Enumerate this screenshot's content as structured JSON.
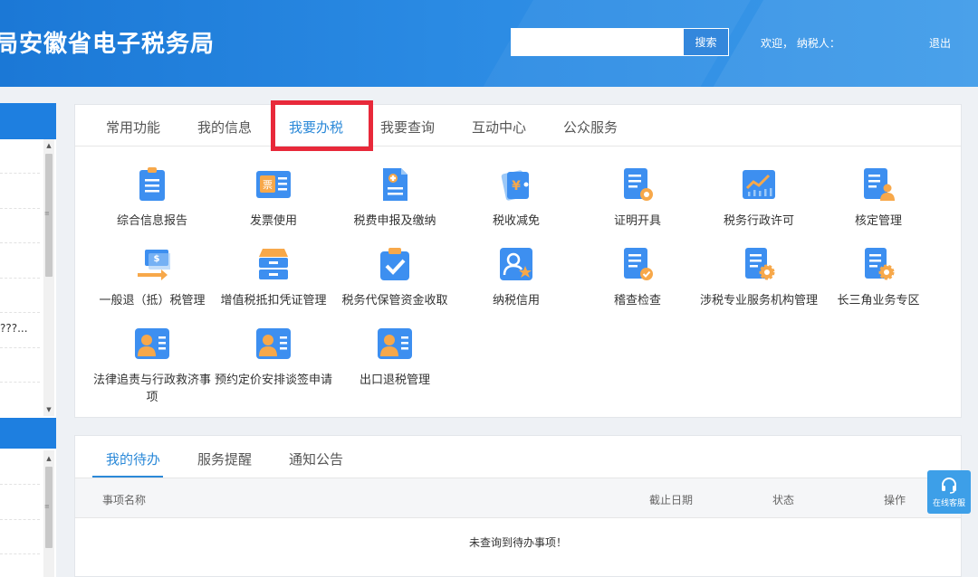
{
  "header": {
    "title": "局安徽省电子税务局",
    "search_placeholder": "",
    "search_button": "搜索",
    "welcome": "欢迎， 纳税人：",
    "logout": "退出"
  },
  "sidebar": {
    "truncated_item": "???..."
  },
  "tabs": [
    {
      "label": "常用功能"
    },
    {
      "label": "我的信息"
    },
    {
      "label": "我要办税",
      "active": true
    },
    {
      "label": "我要查询"
    },
    {
      "label": "互动中心"
    },
    {
      "label": "公众服务"
    }
  ],
  "tiles": [
    {
      "label": "综合信息报告",
      "icon": "report-doc-icon"
    },
    {
      "label": "发票使用",
      "icon": "invoice-icon"
    },
    {
      "label": "税费申报及缴纳",
      "icon": "declaration-icon"
    },
    {
      "label": "税收减免",
      "icon": "tax-reduction-icon"
    },
    {
      "label": "证明开具",
      "icon": "certificate-icon"
    },
    {
      "label": "税务行政许可",
      "icon": "admin-permit-chart-icon"
    },
    {
      "label": "核定管理",
      "icon": "verification-mgmt-icon"
    },
    {
      "label": "一般退（抵）税管理",
      "icon": "refund-money-icon"
    },
    {
      "label": "增值税抵扣凭证管理",
      "icon": "vat-cabinet-icon"
    },
    {
      "label": "税务代保管资金收取",
      "icon": "custody-check-icon"
    },
    {
      "label": "纳税信用",
      "icon": "credit-user-star-icon"
    },
    {
      "label": "稽查检查",
      "icon": "inspection-doc-icon"
    },
    {
      "label": "涉税专业服务机构管理",
      "icon": "agency-gear-icon"
    },
    {
      "label": "长三角业务专区",
      "icon": "yangtze-gear-icon"
    },
    {
      "label": "法律追责与行政救济事项",
      "icon": "legal-id-card-icon"
    },
    {
      "label": "预约定价安排谈签申请",
      "icon": "pricing-id-card-icon"
    },
    {
      "label": "出口退税管理",
      "icon": "export-refund-id-card-icon"
    }
  ],
  "todo": {
    "tabs": [
      {
        "label": "我的待办",
        "active": true
      },
      {
        "label": "服务提醒"
      },
      {
        "label": "通知公告"
      }
    ],
    "columns": [
      "事项名称",
      "截止日期",
      "状态",
      "操作"
    ],
    "empty_message": "未查询到待办事项！"
  },
  "online_service": "在线客服",
  "colors": {
    "header_blue": "#1b78d6",
    "accent_blue": "#2b89d8",
    "highlight_red": "#e8293a"
  }
}
